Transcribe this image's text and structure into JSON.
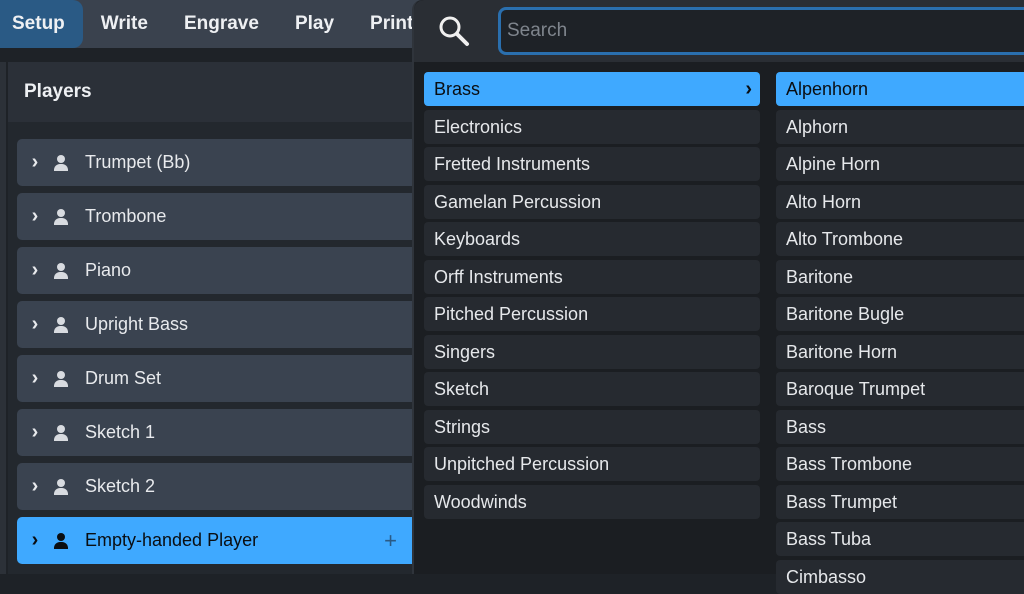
{
  "tabs": [
    "Setup",
    "Write",
    "Engrave",
    "Play",
    "Print"
  ],
  "players": {
    "title": "Players",
    "items": [
      "Trumpet (Bb)",
      "Trombone",
      "Piano",
      "Upright Bass",
      "Drum Set",
      "Sketch 1",
      "Sketch 2",
      "Empty-handed Player"
    ]
  },
  "search": {
    "placeholder": "Search",
    "value": ""
  },
  "categories": [
    "Brass",
    "Electronics",
    "Fretted Instruments",
    "Gamelan Percussion",
    "Keyboards",
    "Orff Instruments",
    "Pitched Percussion",
    "Singers",
    "Sketch",
    "Strings",
    "Unpitched Percussion",
    "Woodwinds"
  ],
  "instruments": [
    "Alpenhorn",
    "Alphorn",
    "Alpine Horn",
    "Alto Horn",
    "Alto Trombone",
    "Baritone",
    "Baritone Bugle",
    "Baritone Horn",
    "Baroque Trumpet",
    "Bass",
    "Bass Trombone",
    "Bass Trumpet",
    "Bass Tuba",
    "Cimbasso"
  ],
  "colors": {
    "accent": "#3fa9ff",
    "active_tab": "#2a5a85"
  }
}
